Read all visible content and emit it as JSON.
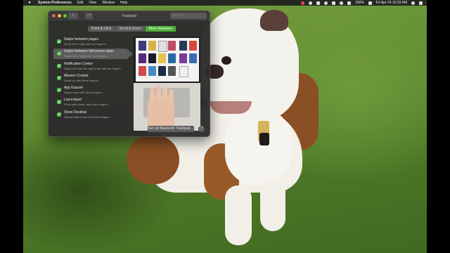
{
  "menubar": {
    "apple": "",
    "items": [
      "System Preferences",
      "Edit",
      "View",
      "Window",
      "Help"
    ],
    "battery": "100%",
    "clock": "Fri Apr 24  10:33 AM"
  },
  "window": {
    "title": "Trackpad",
    "search_placeholder": "Search",
    "back_glyph": "‹",
    "forward_glyph": "›",
    "grid_glyph": "⋯",
    "tabs": [
      {
        "label": "Point & Click",
        "active": false
      },
      {
        "label": "Scroll & Zoom",
        "active": false
      },
      {
        "label": "More Gestures",
        "active": true
      }
    ],
    "gestures": [
      {
        "title": "Swipe between pages",
        "subtitle": "Scroll left or right with two fingers ⌄",
        "checked": true,
        "selected": false
      },
      {
        "title": "Swipe between full-screen apps",
        "subtitle": "Swipe left or right with four fingers ⌄",
        "checked": true,
        "selected": true
      },
      {
        "title": "Notification Center",
        "subtitle": "Swipe left from the right edge with two fingers",
        "checked": true,
        "selected": false
      },
      {
        "title": "Mission Control",
        "subtitle": "Swipe up with three fingers ⌄",
        "checked": true,
        "selected": false
      },
      {
        "title": "App Exposé",
        "subtitle": "Swipe down with three fingers ⌄",
        "checked": true,
        "selected": false
      },
      {
        "title": "Launchpad",
        "subtitle": "Pinch with thumb and three fingers",
        "checked": true,
        "selected": false
      },
      {
        "title": "Show Desktop",
        "subtitle": "Spread with thumb and three fingers",
        "checked": true,
        "selected": false
      }
    ],
    "bluetooth_button": "Set Up Bluetooth Trackpad…",
    "help_label": "?"
  },
  "colors": {
    "accent": "#4caf34",
    "checkbox": "#45b43a",
    "window_bg": "#2c2c2c"
  }
}
